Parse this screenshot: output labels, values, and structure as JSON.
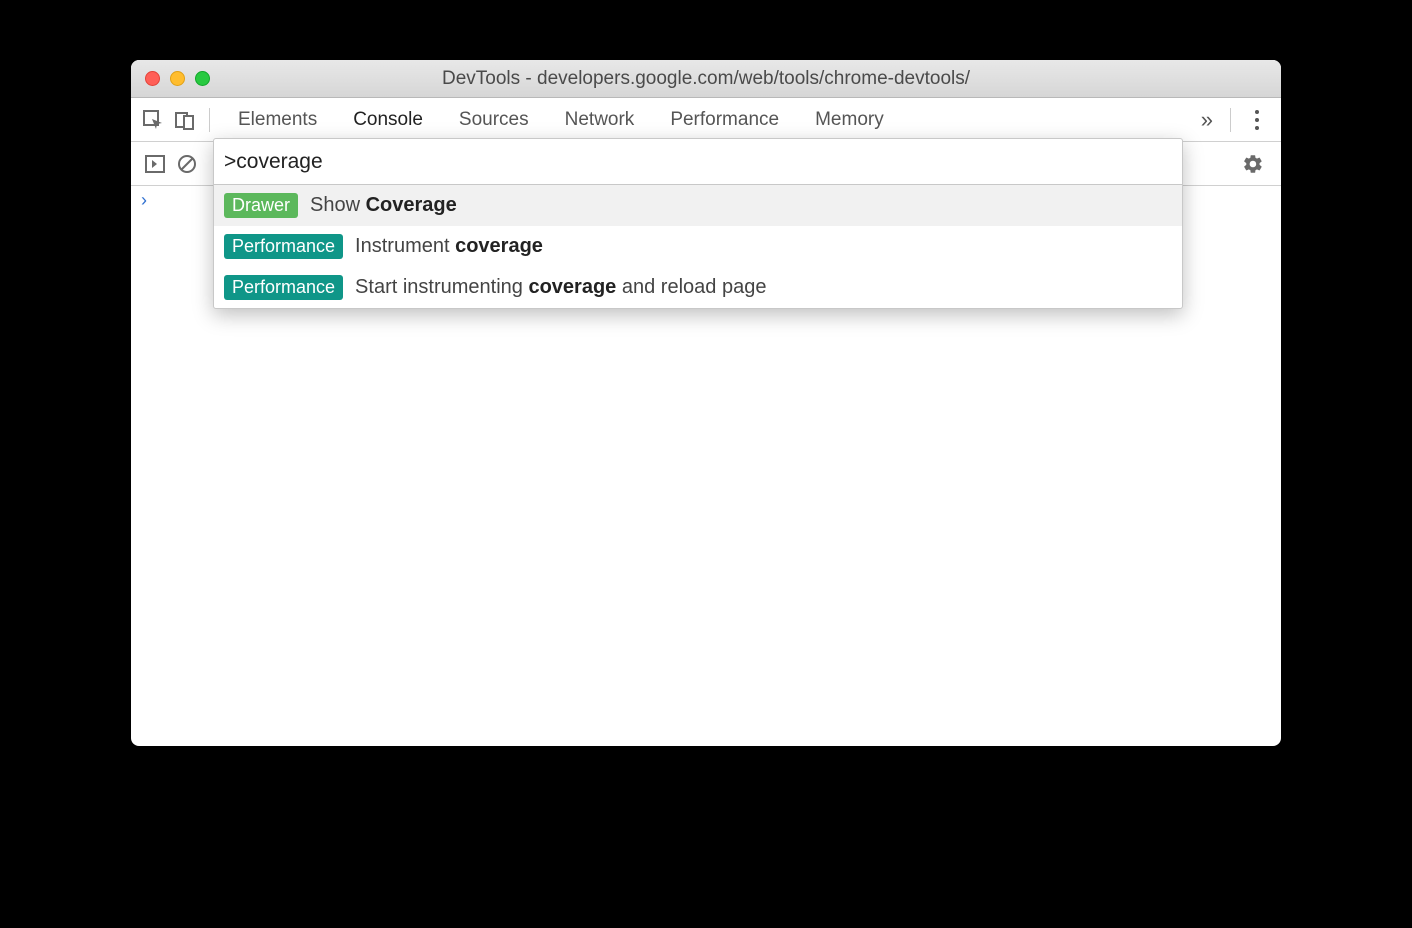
{
  "window": {
    "title": "DevTools - developers.google.com/web/tools/chrome-devtools/"
  },
  "tabs": {
    "items": [
      "Elements",
      "Console",
      "Sources",
      "Network",
      "Performance",
      "Memory"
    ],
    "activeIndex": 1
  },
  "command": {
    "query": ">coverage"
  },
  "results": [
    {
      "badge": "Drawer",
      "badgeColor": "green",
      "prefix": "Show ",
      "match": "Coverage",
      "suffix": "",
      "selected": true
    },
    {
      "badge": "Performance",
      "badgeColor": "teal",
      "prefix": "Instrument ",
      "match": "coverage",
      "suffix": "",
      "selected": false
    },
    {
      "badge": "Performance",
      "badgeColor": "teal",
      "prefix": "Start instrumenting ",
      "match": "coverage",
      "suffix": " and reload page",
      "selected": false
    }
  ],
  "consolePrompt": "›"
}
